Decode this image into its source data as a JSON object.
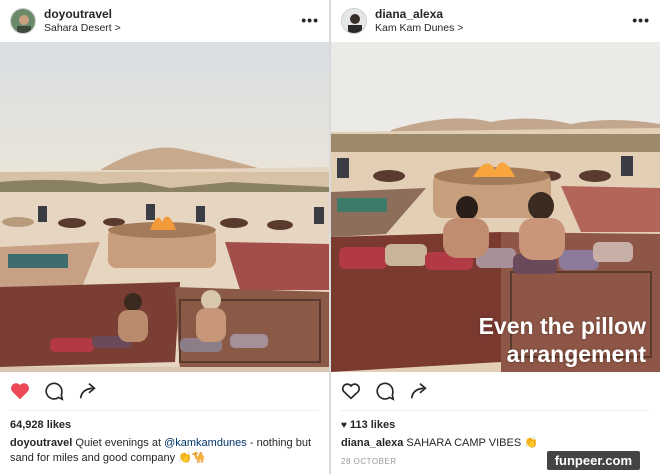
{
  "posts": [
    {
      "username": "doyoutravel",
      "location": "Sahara Desert >",
      "liked": true,
      "likes": "64,928 likes",
      "caption_user": "doyoutravel",
      "caption_text_1": " Quiet evenings at ",
      "caption_mention": "@kamkamdunes",
      "caption_text_2": " - nothing but sand for miles and good company 👏🐪",
      "date": "",
      "overlay_line_1": "",
      "overlay_line_2": ""
    },
    {
      "username": "diana_alexa",
      "location": "Kam Kam Dunes >",
      "liked": false,
      "likes": "113 likes",
      "caption_user": "diana_alexa",
      "caption_text_1": " SAHARA CAMP VIBES 👏",
      "caption_mention": "",
      "caption_text_2": "",
      "date": "28 OCTOBER",
      "overlay_line_1": "Even the pillow",
      "overlay_line_2": "arrangement"
    }
  ],
  "icons": {
    "more": "•••",
    "heart_filled_color": "#ed4956",
    "outline_color": "#262626"
  },
  "watermark": "funpeer.com"
}
